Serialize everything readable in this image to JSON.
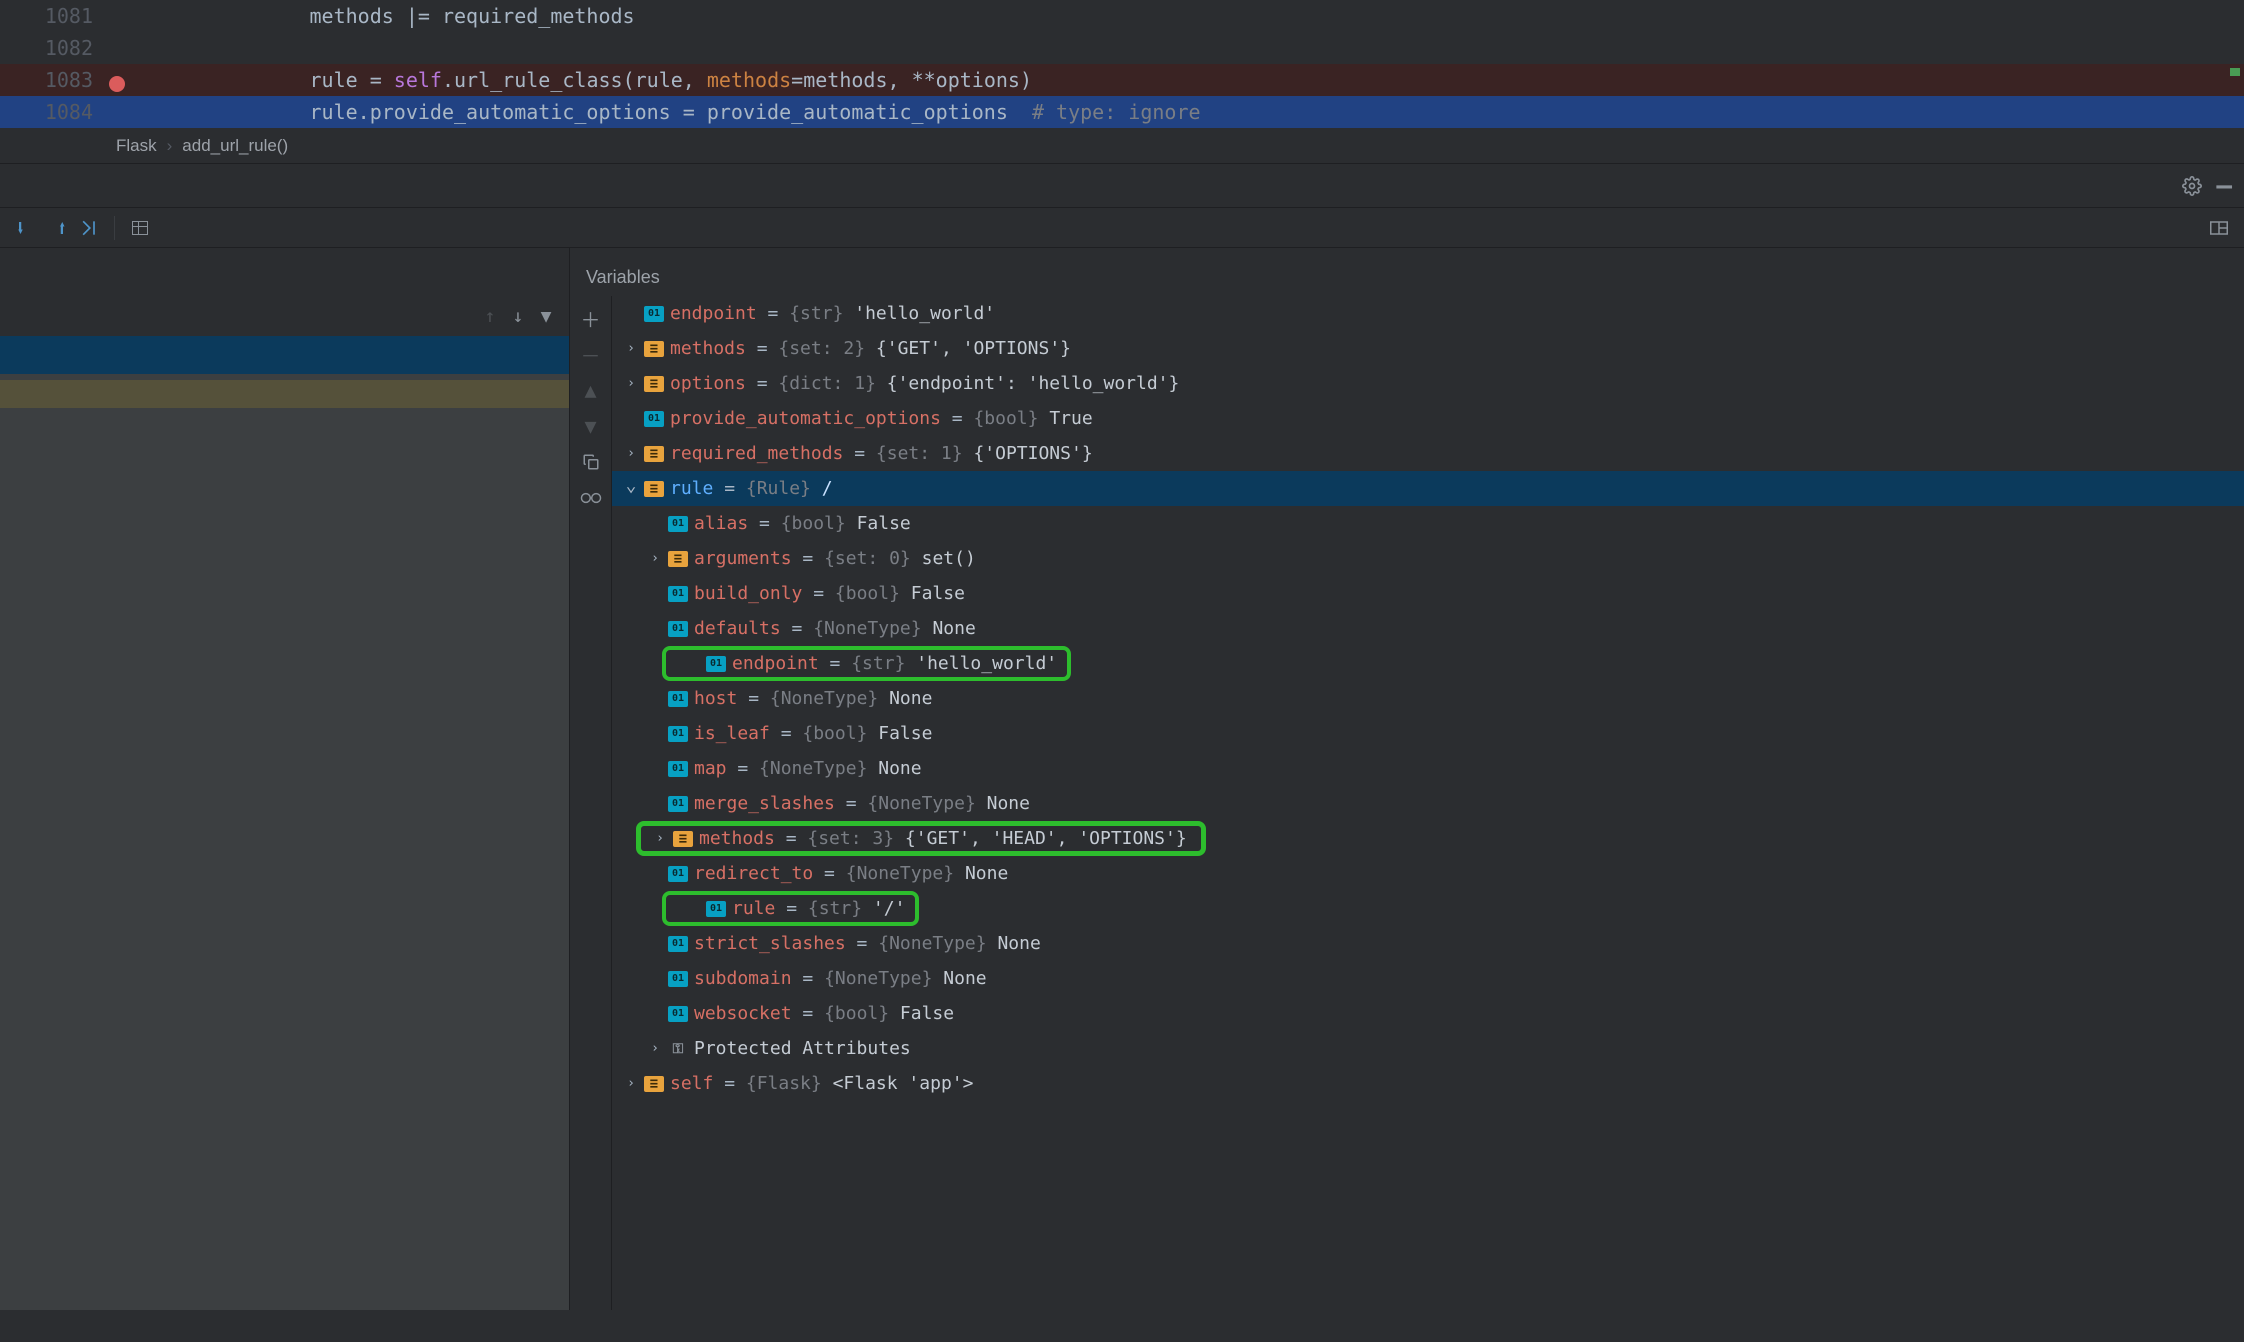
{
  "editor": {
    "lines": [
      {
        "num": "1081",
        "seg": [
          [
            "tok-default",
            "            methods |= required_methods"
          ]
        ]
      },
      {
        "num": "1082",
        "seg": [
          [
            "tok-default",
            ""
          ]
        ]
      },
      {
        "num": "1083",
        "bp": true,
        "bg": "bp",
        "seg": [
          [
            "tok-default",
            "            rule = "
          ],
          [
            "tok-self",
            "self"
          ],
          [
            "tok-default",
            "."
          ],
          [
            "tok-default",
            "url_rule_class(rule"
          ],
          [
            "tok-default",
            ", "
          ],
          [
            "tok-arg",
            "methods"
          ],
          [
            "tok-default",
            "=methods, **options)"
          ]
        ]
      },
      {
        "num": "1084",
        "bg": "cur",
        "seg": [
          [
            "tok-default",
            "            rule.provide_automatic_options = provide_automatic_options  "
          ],
          [
            "tok-comment",
            "# type: ignore"
          ]
        ]
      }
    ]
  },
  "breadcrumb": {
    "a": "Flask",
    "b": "add_url_rule()"
  },
  "panel": {
    "title": "Variables"
  },
  "vars": [
    {
      "ind": 1,
      "chev": "",
      "icon": "01",
      "name": "endpoint",
      "type": "{str}",
      "val": "'hello_world'"
    },
    {
      "ind": 1,
      "chev": ">",
      "icon": "li",
      "name": "methods",
      "type": "{set: 2}",
      "val": "{'GET', 'OPTIONS'}"
    },
    {
      "ind": 1,
      "chev": ">",
      "icon": "li",
      "name": "options",
      "type": "{dict: 1}",
      "val": "{'endpoint': 'hello_world'}"
    },
    {
      "ind": 1,
      "chev": "",
      "icon": "01",
      "name": "provide_automatic_options",
      "type": "{bool}",
      "val": "True"
    },
    {
      "ind": 1,
      "chev": ">",
      "icon": "li",
      "name": "required_methods",
      "type": "{set: 1}",
      "val": "{'OPTIONS'}"
    },
    {
      "ind": 1,
      "chev": "v",
      "icon": "li",
      "name": "rule",
      "type": "{Rule}",
      "val": "/",
      "sel": true
    },
    {
      "ind": 2,
      "chev": "",
      "icon": "01",
      "name": "alias",
      "type": "{bool}",
      "val": "False"
    },
    {
      "ind": 2,
      "chev": ">",
      "icon": "li",
      "name": "arguments",
      "type": "{set: 0}",
      "val": "set()"
    },
    {
      "ind": 2,
      "chev": "",
      "icon": "01",
      "name": "build_only",
      "type": "{bool}",
      "val": "False"
    },
    {
      "ind": 2,
      "chev": "",
      "icon": "01",
      "name": "defaults",
      "type": "{NoneType}",
      "val": "None"
    },
    {
      "ind": 2,
      "chev": "",
      "icon": "01",
      "name": "endpoint",
      "type": "{str}",
      "val": "'hello_world'",
      "box": "n"
    },
    {
      "ind": 2,
      "chev": "",
      "icon": "01",
      "name": "host",
      "type": "{NoneType}",
      "val": "None"
    },
    {
      "ind": 2,
      "chev": "",
      "icon": "01",
      "name": "is_leaf",
      "type": "{bool}",
      "val": "False"
    },
    {
      "ind": 2,
      "chev": "",
      "icon": "01",
      "name": "map",
      "type": "{NoneType}",
      "val": "None"
    },
    {
      "ind": 2,
      "chev": "",
      "icon": "01",
      "name": "merge_slashes",
      "type": "{NoneType}",
      "val": "None"
    },
    {
      "ind": 2,
      "chev": ">",
      "icon": "li",
      "name": "methods",
      "type": "{set: 3}",
      "val": "{'GET', 'HEAD', 'OPTIONS'}",
      "box": "w"
    },
    {
      "ind": 2,
      "chev": "",
      "icon": "01",
      "name": "redirect_to",
      "type": "{NoneType}",
      "val": "None"
    },
    {
      "ind": 2,
      "chev": "",
      "icon": "01",
      "name": "rule",
      "type": "{str}",
      "val": "'/'",
      "box": "n"
    },
    {
      "ind": 2,
      "chev": "",
      "icon": "01",
      "name": "strict_slashes",
      "type": "{NoneType}",
      "val": "None"
    },
    {
      "ind": 2,
      "chev": "",
      "icon": "01",
      "name": "subdomain",
      "type": "{NoneType}",
      "val": "None"
    },
    {
      "ind": 2,
      "chev": "",
      "icon": "01",
      "name": "websocket",
      "type": "{bool}",
      "val": "False"
    },
    {
      "ind": 2,
      "chev": ">",
      "icon": "key",
      "name_plain": "Protected Attributes"
    },
    {
      "ind": 1,
      "chev": ">",
      "icon": "li",
      "name": "self",
      "type": "{Flask}",
      "val": "<Flask 'app'>"
    }
  ]
}
